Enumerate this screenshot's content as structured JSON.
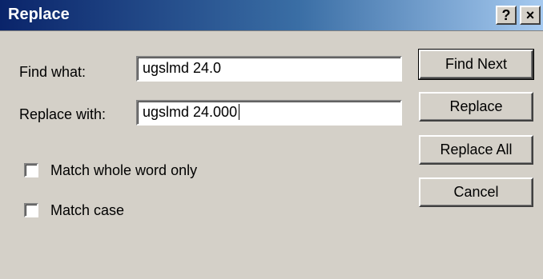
{
  "window": {
    "title": "Replace",
    "help_label": "?",
    "close_label": "×"
  },
  "form": {
    "find_label": "Find what:",
    "find_value": "ugslmd 24.0",
    "replace_label": "Replace with:",
    "replace_value": "ugslmd 24.000"
  },
  "options": {
    "match_whole_word_label": "Match whole word only",
    "match_whole_word_checked": false,
    "match_case_label": "Match case",
    "match_case_checked": false
  },
  "buttons": {
    "find_next": "Find Next",
    "replace": "Replace",
    "replace_all": "Replace All",
    "cancel": "Cancel"
  }
}
